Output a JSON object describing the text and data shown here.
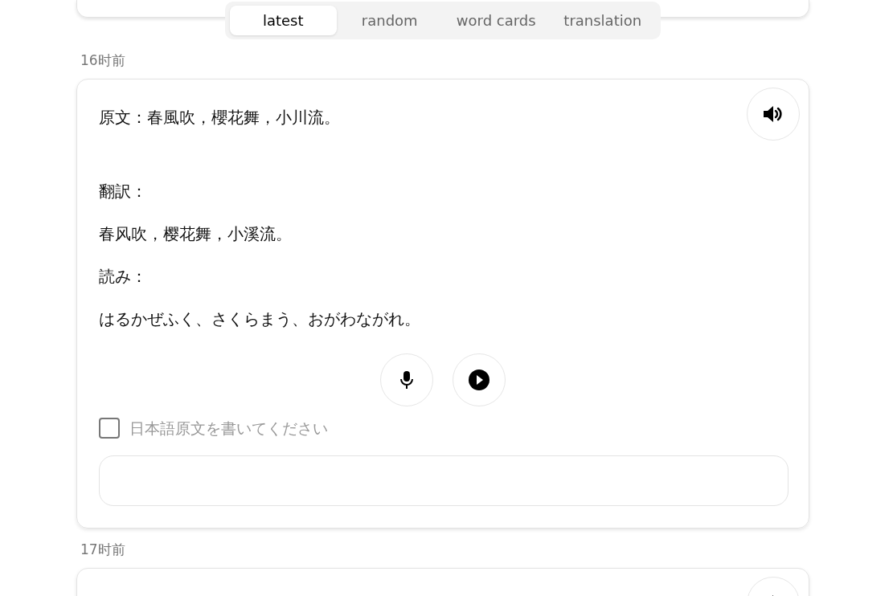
{
  "tabs": [
    {
      "label": "latest",
      "selected": true
    },
    {
      "label": "random",
      "selected": false
    },
    {
      "label": "word cards",
      "selected": false
    },
    {
      "label": "translation",
      "selected": false
    }
  ],
  "entries": [
    {
      "time": "16时前",
      "original": "原文：春風吹，櫻花舞，小川流。",
      "translation_label": "翻訳：",
      "translation": "春风吹，樱花舞，小溪流。",
      "reading_label": "読み：",
      "reading": "はるかぜふく、さくらまう、おがわながれ。",
      "write_check": {
        "label": "日本語原文を書いてください",
        "checked": false
      }
    },
    {
      "time": "17时前"
    }
  ]
}
